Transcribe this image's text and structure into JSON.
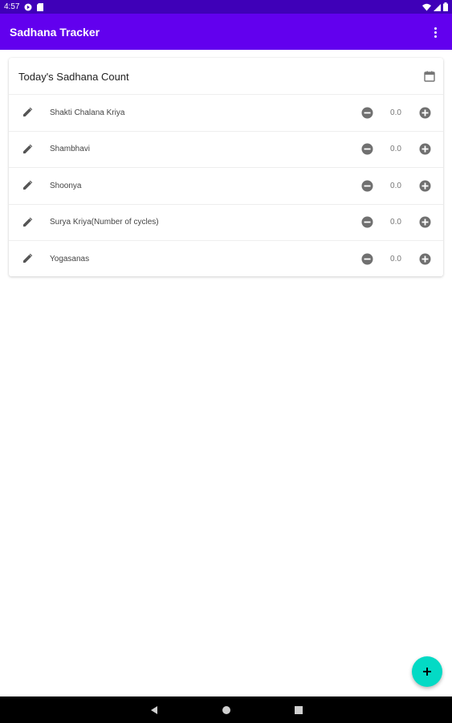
{
  "status_bar": {
    "time": "4:57",
    "left_icons": [
      "google-play-icon",
      "sd-card-icon"
    ],
    "right_icons": [
      "wifi-icon",
      "signal-icon",
      "battery-icon"
    ]
  },
  "app_bar": {
    "title": "Sadhana Tracker",
    "menu_icon": "overflow-menu-icon"
  },
  "card": {
    "title": "Today's Sadhana Count",
    "calendar_icon": "calendar-icon",
    "items": [
      {
        "label": "Shakti Chalana Kriya",
        "value": "0.0"
      },
      {
        "label": "Shambhavi",
        "value": "0.0"
      },
      {
        "label": "Shoonya",
        "value": "0.0"
      },
      {
        "label": "Surya Kriya(Number of cycles)",
        "value": "0.0"
      },
      {
        "label": "Yogasanas",
        "value": "0.0"
      }
    ]
  },
  "fab": {
    "icon": "plus-icon"
  },
  "colors": {
    "status_bar": "#3f00b8",
    "app_bar": "#6200ee",
    "fab": "#03dac5",
    "nav_bar": "#000000"
  }
}
